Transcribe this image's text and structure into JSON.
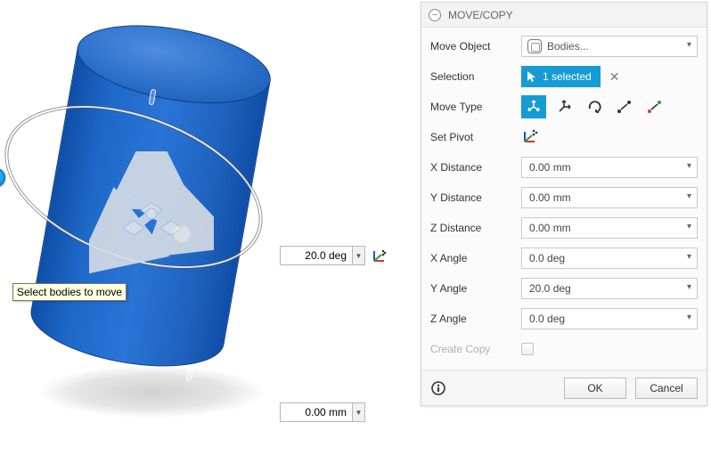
{
  "viewport": {
    "tooltip": "Select bodies to move",
    "angle_input": "20.0 deg",
    "distance_input": "0.00 mm"
  },
  "panel": {
    "title": "MOVE/COPY",
    "move_object": {
      "label": "Move Object",
      "value": "Bodies..."
    },
    "selection": {
      "label": "Selection",
      "chip": "1 selected"
    },
    "move_type": {
      "label": "Move Type"
    },
    "set_pivot": {
      "label": "Set Pivot"
    },
    "x_distance": {
      "label": "X Distance",
      "value": "0.00 mm"
    },
    "y_distance": {
      "label": "Y Distance",
      "value": "0.00 mm"
    },
    "z_distance": {
      "label": "Z Distance",
      "value": "0.00 mm"
    },
    "x_angle": {
      "label": "X Angle",
      "value": "0.0 deg"
    },
    "y_angle": {
      "label": "Y Angle",
      "value": "20.0 deg"
    },
    "z_angle": {
      "label": "Z Angle",
      "value": "0.0 deg"
    },
    "create_copy": {
      "label": "Create Copy"
    },
    "ok_label": "OK",
    "cancel_label": "Cancel"
  }
}
